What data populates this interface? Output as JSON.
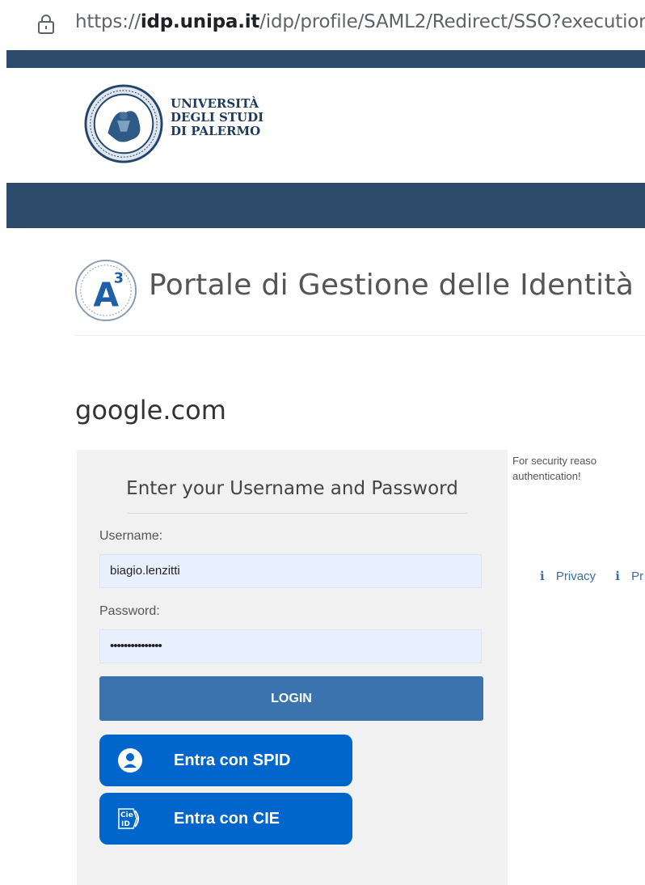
{
  "browser": {
    "url_prefix": "https://",
    "url_host": "idp.unipa.it",
    "url_path": "/idp/profile/SAML2/Redirect/SSO?execution=",
    "lock_icon": "lock-icon"
  },
  "header": {
    "university_lines": [
      "UNIVERSITÀ",
      "DEGLI STUDI",
      "DI PALERMO"
    ],
    "seal_icon": "university-seal-icon"
  },
  "portal": {
    "logo_letter": "A",
    "logo_superscript": "3",
    "title": "Portale di Gestione delle Identità"
  },
  "service_provider": "google.com",
  "login_form": {
    "title": "Enter your Username and Password",
    "username_label": "Username:",
    "username_value": "biagio.lenzitti",
    "password_label": "Password:",
    "password_value": "•••••••••••••••",
    "login_button": "LOGIN",
    "spid_button": "Entra con SPID",
    "spid_icon": "spid-user-icon",
    "cie_button": "Entra con CIE",
    "cie_icon": "cie-id-icon"
  },
  "sidebar": {
    "notice_line1": "For security reaso",
    "notice_line2": "authentication!",
    "links": [
      {
        "icon": "ℹ",
        "label": "Privacy"
      },
      {
        "icon": "ℹ",
        "label": "Pr"
      }
    ]
  },
  "colors": {
    "nav_bar": "#2e4a6b",
    "login_button": "#3a73ad",
    "spid_cie_button": "#0066cc",
    "input_bg": "#e8f0fe",
    "panel_bg": "#f1f1f1"
  }
}
